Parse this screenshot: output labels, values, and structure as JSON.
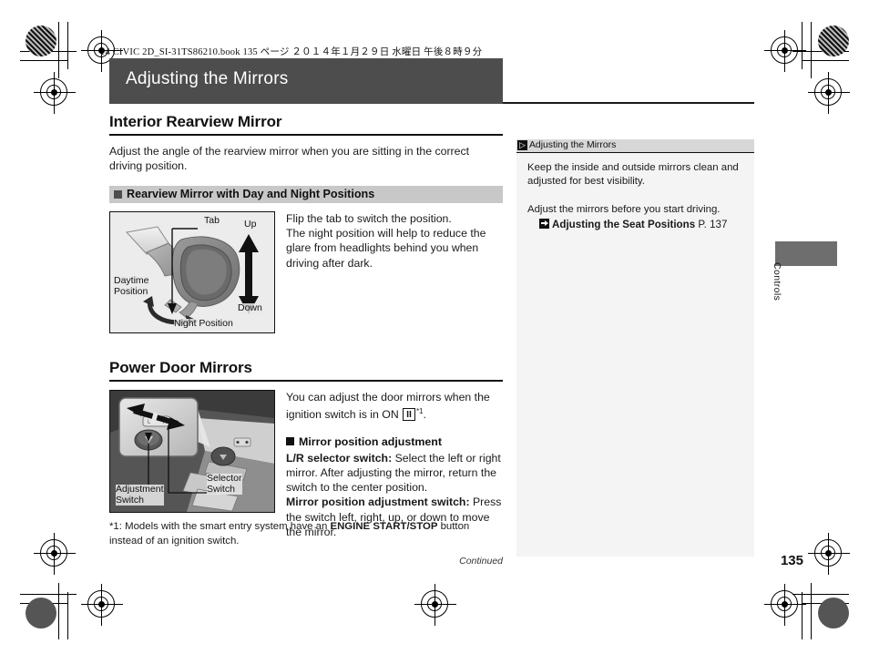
{
  "running_head": "14 CIVIC 2D_SI-31TS86210.book   135 ページ   ２０１４年１月２９日   水曜日   午後８時９分",
  "chapter": {
    "title": "Adjusting the Mirrors"
  },
  "sections": [
    {
      "heading": "Interior Rearview Mirror",
      "intro": "Adjust the angle of the rearview mirror when you are sitting in the correct driving position.",
      "subsection": "Rearview Mirror with Day and Night Positions",
      "figure": {
        "name": "rearview-mirror-illustration",
        "labels": {
          "tab": "Tab",
          "up": "Up",
          "down": "Down",
          "daytime": "Daytime\nPosition",
          "daytime_line1": "Daytime",
          "daytime_line2": "Position",
          "night": "Night Position"
        }
      },
      "body": [
        "Flip the tab to switch the position.",
        "The night position will help to reduce the glare from headlights behind you when driving after dark."
      ]
    },
    {
      "heading": "Power Door Mirrors",
      "figure": {
        "name": "power-door-mirror-switch-illustration",
        "labels": {
          "adjustment_line1": "Adjustment",
          "adjustment_line2": "Switch",
          "selector_line1": "Selector",
          "selector_line2": "Switch"
        }
      },
      "intro_prefix": "You can adjust the door mirrors when the ignition switch is in ON ",
      "ignition_key": "II",
      "footnote_marker": "*1",
      "intro_suffix": ".",
      "block_heading": "Mirror position adjustment",
      "items": [
        {
          "term": "L/R selector switch:",
          "text": " Select the left or right mirror. After adjusting the mirror, return the switch to the center position."
        },
        {
          "term": "Mirror position adjustment switch:",
          "text": " Press the switch left, right, up, or down to move the mirror."
        }
      ]
    }
  ],
  "footnote": {
    "marker": "*1: ",
    "text_before": "Models with the smart entry system have an ",
    "bold": "ENGINE START/STOP",
    "text_after": " button instead of an ignition switch."
  },
  "continued": "Continued",
  "note": {
    "icon": "note-marker-icon",
    "title": "Adjusting the Mirrors",
    "paragraph1": "Keep the inside and outside mirrors clean and adjusted for best visibility.",
    "paragraph2": "Adjust the mirrors before you start driving.",
    "xref": {
      "icon": "cross-reference-arrow-icon",
      "label": "Adjusting the Seat Positions",
      "page": "P. 137"
    }
  },
  "thumb_tab": {
    "label": "Controls"
  },
  "page_number": "135",
  "colors": {
    "title_bar": "#4d4d4d",
    "subsection_band": "#c8c8c8",
    "note_background": "#f4f4f4",
    "note_head": "#d7d7d7",
    "thumb_tab": "#6e6e6e"
  }
}
